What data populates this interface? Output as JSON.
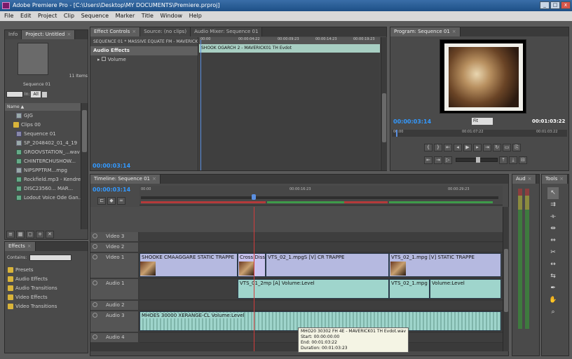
{
  "window": {
    "title": "Adobe Premiere Pro - [C:\\Users\\Desktop\\MY DOCUMENTS\\Premiere.prproj]",
    "min": "_",
    "max": "□",
    "close": "x"
  },
  "menu": [
    "File",
    "Edit",
    "Project",
    "Clip",
    "Sequence",
    "Marker",
    "Title",
    "Window",
    "Help"
  ],
  "project": {
    "tabs": [
      {
        "label": "Info"
      },
      {
        "label": "Project: Untitled"
      }
    ],
    "item_count": "11 Items",
    "bin_label": "Sequence 01",
    "in_label": "In:",
    "in_value": "All",
    "column_header": "Name",
    "items": [
      {
        "label": "GJG",
        "icon": "clip"
      },
      {
        "label": "Clips 00",
        "icon": "folder"
      },
      {
        "label": "Sequence 01",
        "icon": "seq"
      },
      {
        "label": "SP_2048402_01_4_19",
        "icon": "clip"
      },
      {
        "label": "GROOVSTATION_...wav",
        "icon": "audio"
      },
      {
        "label": "CHINTERCHUSHOW...",
        "icon": "audio"
      },
      {
        "label": "NIPSPPTRM...mpg",
        "icon": "clip"
      },
      {
        "label": "Rockfield.mp3 - Kendrey...",
        "icon": "audio"
      },
      {
        "label": "DISC23560... MAR...",
        "icon": "audio"
      },
      {
        "label": "Lodout Voice Ode Gan...",
        "icon": "audio"
      }
    ]
  },
  "effects": {
    "tabs": [
      {
        "label": "Effects"
      }
    ],
    "contains_label": "Contains:",
    "folders": [
      "Presets",
      "Audio Effects",
      "Audio Transitions",
      "Video Effects",
      "Video Transitions"
    ]
  },
  "effect_controls": {
    "tabs": [
      {
        "label": "Effect Controls"
      },
      {
        "label": "Source: (no clips)"
      },
      {
        "label": "Audio Mixer: Sequence 01"
      }
    ],
    "sequence_label": "SEQUENCE 01 * MASSIVE EQUATE FM - MAVERICK01",
    "section": "Audio Effects",
    "property": "Volume",
    "timecode": "00:00:03:14",
    "ruler": [
      "00:00",
      "00:00:04:22",
      "00:00:09:23",
      "00:00:14:23",
      "00:00:19:23"
    ],
    "clip_label": "SHOOK OGARCH 2 - MAVERICK01 TH Evdot"
  },
  "program": {
    "tabs": [
      {
        "label": "Program: Sequence 01"
      }
    ],
    "timecode": "00:00:03:14",
    "fit": "Fit",
    "duration": "00:01:03:22",
    "ruler": [
      "00:00",
      "00:01:07:22",
      "00:01:03:22"
    ]
  },
  "timeline": {
    "tabs": [
      {
        "label": "Timeline: Sequence 01"
      }
    ],
    "timecode": "00:00:03:14",
    "ruler": [
      "00:00",
      "00:00:16:23",
      "00:00:29:23"
    ],
    "tracks": [
      {
        "name": "Video 3"
      },
      {
        "name": "Video 2"
      },
      {
        "name": "Video 1"
      },
      {
        "name": "Audio 1"
      },
      {
        "name": "Audio 2"
      },
      {
        "name": "Audio 3"
      },
      {
        "name": "Audio 4"
      }
    ],
    "clips": {
      "v1a": "SHOOKE CMAAGGARE STATIC TRAPPE",
      "v1b": "Cross Dissolve",
      "v1c": "VTS_02_1.mpgS [V] CR TRAPPE",
      "v1d": "VTS_02_1.mpg [V] STATIC TRAPPE",
      "a1a": "VTS_01_2mp [A] Volume:Level",
      "a1b": "VTS_02_1.mpg [A]",
      "a1c": "Volume:Level",
      "a3": "MHOES 30000 XERANGE-CL Volume:Level"
    },
    "tooltip": {
      "line1": "MHO20 30302 FH 4E - MAVERICK01 TH Evdot.wav",
      "line2": "Start: 00:00:00:00",
      "line3": "End: 00:01:03:22",
      "line4": "Duration: 00:01:03:23"
    }
  },
  "audio_meters": {
    "tabs": [
      {
        "label": "Aud"
      }
    ]
  },
  "tools": {
    "tabs": [
      {
        "label": "Tools"
      }
    ]
  }
}
